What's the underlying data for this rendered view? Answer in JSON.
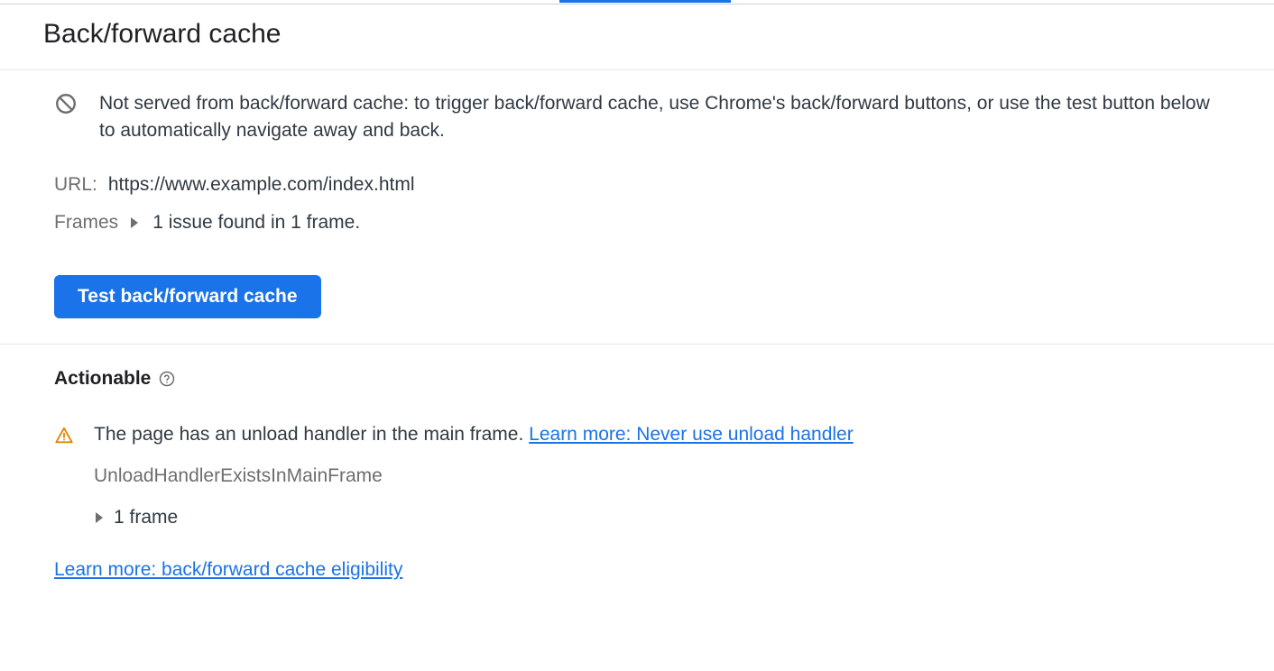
{
  "header": {
    "title": "Back/forward cache"
  },
  "status": {
    "message": "Not served from back/forward cache: to trigger back/forward cache, use Chrome's back/forward buttons, or use the test button below to automatically navigate away and back."
  },
  "url": {
    "label": "URL:",
    "value": "https://www.example.com/index.html"
  },
  "frames": {
    "label": "Frames",
    "summary": "1 issue found in 1 frame."
  },
  "buttons": {
    "test_label": "Test back/forward cache"
  },
  "section": {
    "title": "Actionable"
  },
  "issue": {
    "text": "The page has an unload handler in the main frame. ",
    "link_text": "Learn more: Never use unload handler",
    "reason_code": "UnloadHandlerExistsInMainFrame",
    "frame_count": "1 frame"
  },
  "footer": {
    "link_text": "Learn more: back/forward cache eligibility"
  }
}
